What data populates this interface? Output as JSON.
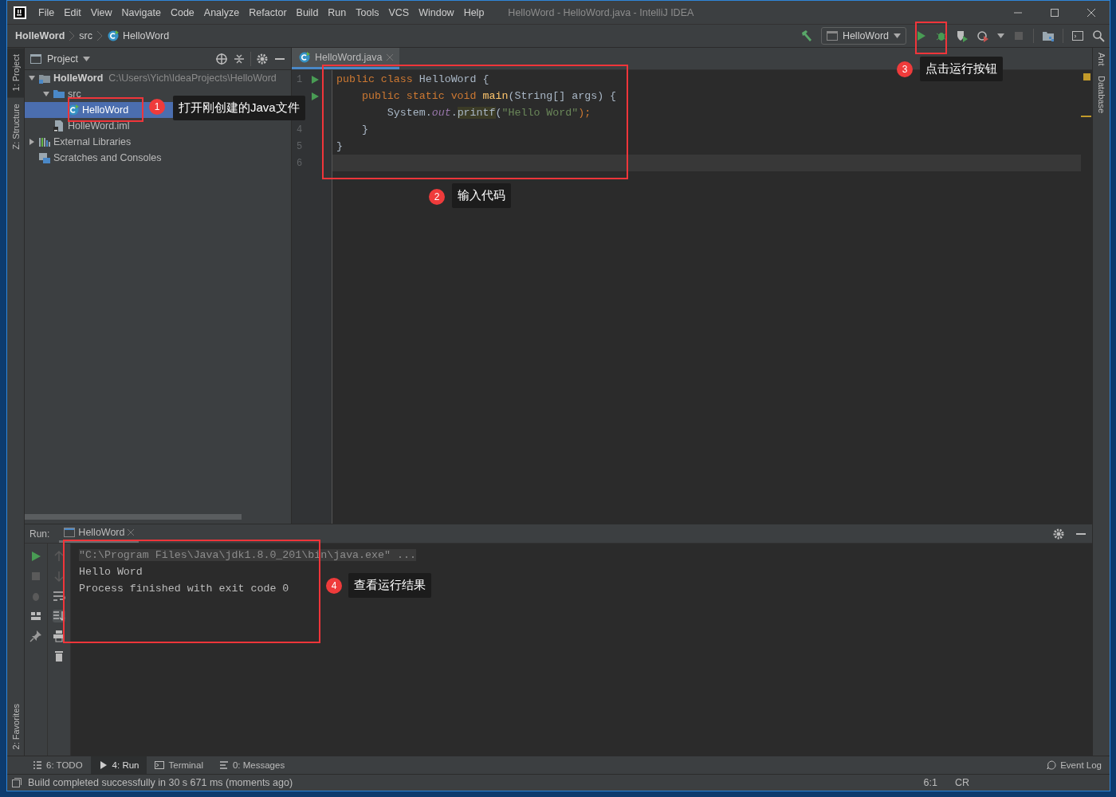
{
  "window": {
    "title": "HelloWord - HelloWord.java - IntelliJ IDEA"
  },
  "menu": [
    "File",
    "Edit",
    "View",
    "Navigate",
    "Code",
    "Analyze",
    "Refactor",
    "Build",
    "Run",
    "Tools",
    "VCS",
    "Window",
    "Help"
  ],
  "breadcrumb": [
    {
      "label": "HolleWord",
      "kind": "module"
    },
    {
      "label": "src",
      "kind": "folder"
    },
    {
      "label": "HelloWord",
      "kind": "class"
    }
  ],
  "run_config": {
    "label": "HelloWord"
  },
  "left_strip": {
    "top": [
      {
        "label": "1: Project",
        "selected": true
      },
      {
        "label": "Z: Structure",
        "selected": false
      }
    ],
    "bottom": [
      {
        "label": "2: Favorites",
        "selected": false
      }
    ]
  },
  "right_strip": [
    "Ant",
    "Database"
  ],
  "project": {
    "title": "Project",
    "tree": [
      {
        "label": "HolleWord",
        "path": "C:\\Users\\Yich\\IdeaProjects\\HelloWord",
        "kind": "module",
        "expanded": true,
        "selected": false,
        "children": [
          {
            "label": "src",
            "kind": "folder",
            "expanded": true,
            "selected": false,
            "children": [
              {
                "label": "HelloWord",
                "kind": "class",
                "selected": true
              }
            ]
          },
          {
            "label": "HolleWord.iml",
            "kind": "file",
            "selected": false
          }
        ]
      },
      {
        "label": "External Libraries",
        "kind": "libraries",
        "expanded": false,
        "selected": false
      },
      {
        "label": "Scratches and Consoles",
        "kind": "scratches",
        "selected": false
      }
    ]
  },
  "editor": {
    "tab": {
      "label": "HelloWord.java",
      "selected": true
    },
    "lines": [
      {
        "number": "1",
        "runnable": true,
        "current": false,
        "tokens": [
          {
            "text": "public class ",
            "kind": "keyword"
          },
          {
            "text": "HelloWord {",
            "kind": "plain"
          }
        ]
      },
      {
        "runnable": true,
        "current": false,
        "tokens": [
          {
            "text": "    public static void ",
            "kind": "keyword"
          },
          {
            "text": "main",
            "kind": "method"
          },
          {
            "text": "(String[] args) {",
            "kind": "plain"
          }
        ]
      },
      {
        "runnable": false,
        "current": false,
        "tokens": [
          {
            "text": "        System.",
            "kind": "plain"
          },
          {
            "text": "out",
            "kind": "static"
          },
          {
            "text": ".",
            "kind": "plain"
          },
          {
            "text": "printf",
            "kind": "usage"
          },
          {
            "text": "(",
            "kind": "plain"
          },
          {
            "text": "\"Hello Word\"",
            "kind": "string"
          },
          {
            "text": ");",
            "kind": "keyword"
          }
        ]
      },
      {
        "number": "4",
        "runnable": false,
        "current": false,
        "tokens": [
          {
            "text": "    }",
            "kind": "plain"
          }
        ]
      },
      {
        "number": "5",
        "runnable": false,
        "current": false,
        "tokens": [
          {
            "text": "}",
            "kind": "plain"
          }
        ]
      },
      {
        "number": "6",
        "runnable": false,
        "current": true
      }
    ]
  },
  "run_panel": {
    "label": "Run:",
    "tab": "HelloWord",
    "output": [
      {
        "text": "\"C:\\Program Files\\Java\\jdk1.8.0_201\\bin\\java.exe\" ...",
        "kind": "command"
      },
      {
        "text": "Hello Word",
        "kind": "plain"
      },
      {
        "text": "Process finished with exit code 0",
        "kind": "plain"
      }
    ]
  },
  "tool_tabs": [
    {
      "label": "6: TODO",
      "kind": "list",
      "selected": false
    },
    {
      "label": "4: Run",
      "kind": "run",
      "selected": true
    },
    {
      "label": "Terminal",
      "kind": "terminal",
      "selected": false
    },
    {
      "label": "0: Messages",
      "kind": "messages",
      "selected": false
    }
  ],
  "event_log": "Event Log",
  "status_bar": {
    "message": "Build completed successfully in 30 s 671 ms (moments ago)",
    "position": "6:1",
    "line_sep": "CR"
  },
  "annotations": [
    {
      "number": "1",
      "text": "打开刚创建的Java文件"
    },
    {
      "number": "2",
      "text": "输入代码"
    },
    {
      "number": "3",
      "text": "点击运行按钮"
    },
    {
      "number": "4",
      "text": "查看运行结果"
    }
  ]
}
